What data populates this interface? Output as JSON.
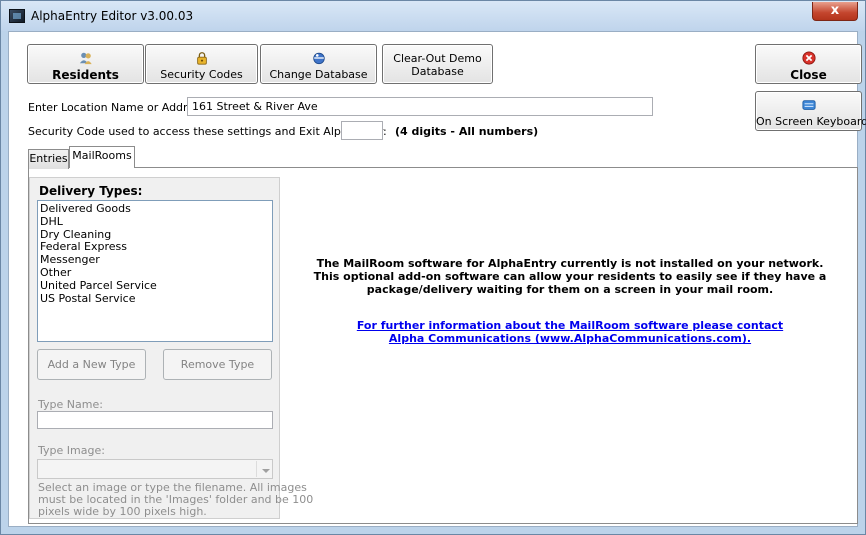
{
  "window": {
    "title": "AlphaEntry Editor v3.00.03",
    "close_glyph": "x"
  },
  "toolbar": {
    "residents_label": "Residents",
    "security_codes_label": "Security Codes",
    "change_database_label": "Change Database",
    "clear_out_line1": "Clear-Out Demo",
    "clear_out_line2": "Database",
    "close_label": "Close",
    "keyboard_label": "On Screen Keyboard"
  },
  "location": {
    "label": "Enter Location Name or Address:",
    "value": "161 Street & River Ave"
  },
  "security": {
    "label": "Security Code used to access these settings and Exit AlphaEntry:",
    "value": "",
    "hint": "(4 digits - All numbers)"
  },
  "tabs": [
    {
      "label": "Entries",
      "active": false
    },
    {
      "label": "MailRooms",
      "active": true
    }
  ],
  "delivery": {
    "title": "Delivery Types:",
    "items": [
      "Delivered Goods",
      "DHL",
      "Dry Cleaning",
      "Federal Express",
      "Messenger",
      "Other",
      "United Parcel Service",
      "US Postal Service"
    ],
    "add_label": "Add a New Type",
    "remove_label": "Remove Type",
    "type_name_label": "Type Name:",
    "type_name_value": "",
    "type_image_label": "Type Image:",
    "type_image_value": "",
    "help_line1": "Select an image or type the filename. All images",
    "help_line2": "must be located in the 'Images' folder and be 100",
    "help_line3": "pixels wide by 100 pixels high."
  },
  "info": {
    "line1": "The MailRoom software for AlphaEntry currently is not installed on your network.",
    "line2": "This optional add-on software can allow your residents to easily see if they have a",
    "line3": "package/delivery waiting for them on a screen in your mail room.",
    "link_line1": "For further information about the MailRoom software please contact",
    "link_line2": "Alpha Communications (www.AlphaCommunications.com)."
  },
  "icons": {
    "residents": "people-icon",
    "security": "lock-icon",
    "database": "database-icon",
    "close": "close-circle-icon",
    "keyboard": "keyboard-icon"
  },
  "colors": {
    "title_bar": "#bfd4ec",
    "close_red": "#c4452d",
    "link_blue": "#0000ee"
  }
}
